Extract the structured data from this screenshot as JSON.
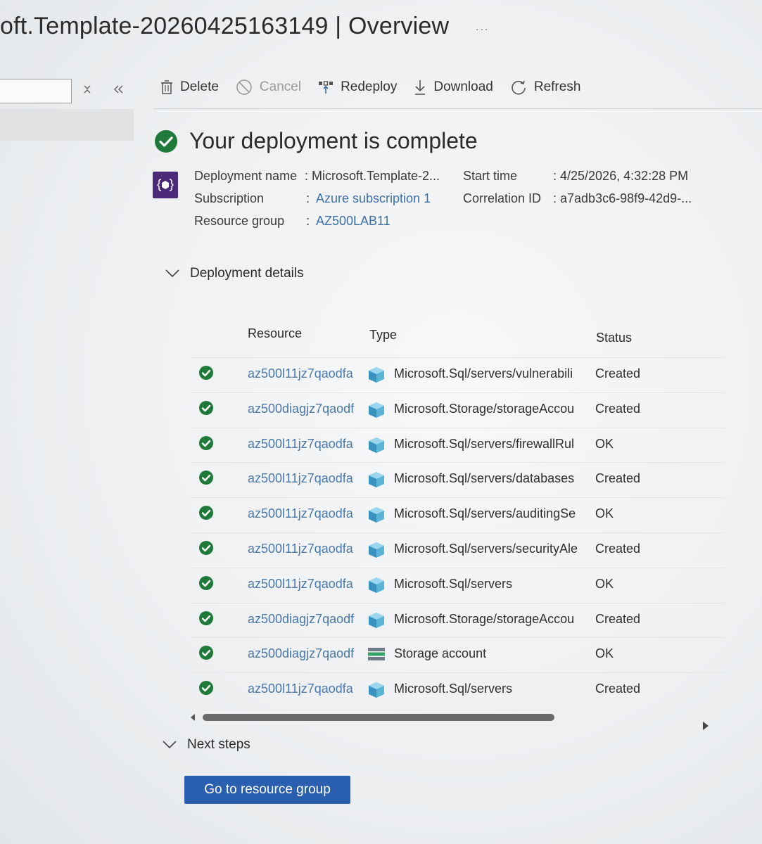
{
  "page": {
    "title": "oft.Template-20260425163149 | Overview",
    "more": "..."
  },
  "sidebar": {
    "search_value": "",
    "icons": [
      "clear-icon",
      "collapse-icon"
    ]
  },
  "toolbar": {
    "delete_label": "Delete",
    "cancel_label": "Cancel",
    "redeploy_label": "Redeploy",
    "download_label": "Download",
    "refresh_label": "Refresh"
  },
  "status": {
    "title": "Your deployment is complete"
  },
  "info": {
    "deployment_name_label": "Deployment name",
    "deployment_name_value": ": Microsoft.Template-2...",
    "subscription_label": "Subscription",
    "subscription_sep": ":",
    "subscription_value": "Azure subscription 1",
    "resource_group_label": "Resource group",
    "resource_group_sep": ":",
    "resource_group_value": "AZ500LAB11",
    "start_time_label": "Start time",
    "start_time_value": ": 4/25/2026, 4:32:28 PM",
    "correlation_id_label": "Correlation ID",
    "correlation_id_value": ": a7adb3c6-98f9-42d9-..."
  },
  "details": {
    "label": "Deployment details",
    "columns": {
      "resource": "Resource",
      "type": "Type",
      "status": "Status"
    },
    "rows": [
      {
        "resource": "az500l11jz7qaodfa",
        "type": "Microsoft.Sql/servers/vulnerabili",
        "status": "Created",
        "icon": "sql"
      },
      {
        "resource": "az500diagjz7qaodf",
        "type": "Microsoft.Storage/storageAccou",
        "status": "Created",
        "icon": "sql"
      },
      {
        "resource": "az500l11jz7qaodfa",
        "type": "Microsoft.Sql/servers/firewallRul",
        "status": "OK",
        "icon": "sql"
      },
      {
        "resource": "az500l11jz7qaodfa",
        "type": "Microsoft.Sql/servers/databases",
        "status": "Created",
        "icon": "sql"
      },
      {
        "resource": "az500l11jz7qaodfa",
        "type": "Microsoft.Sql/servers/auditingSe",
        "status": "OK",
        "icon": "sql"
      },
      {
        "resource": "az500l11jz7qaodfa",
        "type": "Microsoft.Sql/servers/securityAle",
        "status": "Created",
        "icon": "sql"
      },
      {
        "resource": "az500l11jz7qaodfa",
        "type": "Microsoft.Sql/servers",
        "status": "OK",
        "icon": "sql"
      },
      {
        "resource": "az500diagjz7qaodf",
        "type": "Microsoft.Storage/storageAccou",
        "status": "Created",
        "icon": "sql"
      },
      {
        "resource": "az500diagjz7qaodf",
        "type": "Storage account",
        "status": "OK",
        "icon": "storage"
      },
      {
        "resource": "az500l11jz7qaodfa",
        "type": "Microsoft.Sql/servers",
        "status": "Created",
        "icon": "sql"
      }
    ]
  },
  "next_steps": {
    "label": "Next steps",
    "button_label": "Go to resource group"
  },
  "colors": {
    "success": "#1f7a3a",
    "link": "#3e6fa6",
    "primary": "#2a5fb0",
    "deploy_icon_bg": "#4b2a77"
  }
}
